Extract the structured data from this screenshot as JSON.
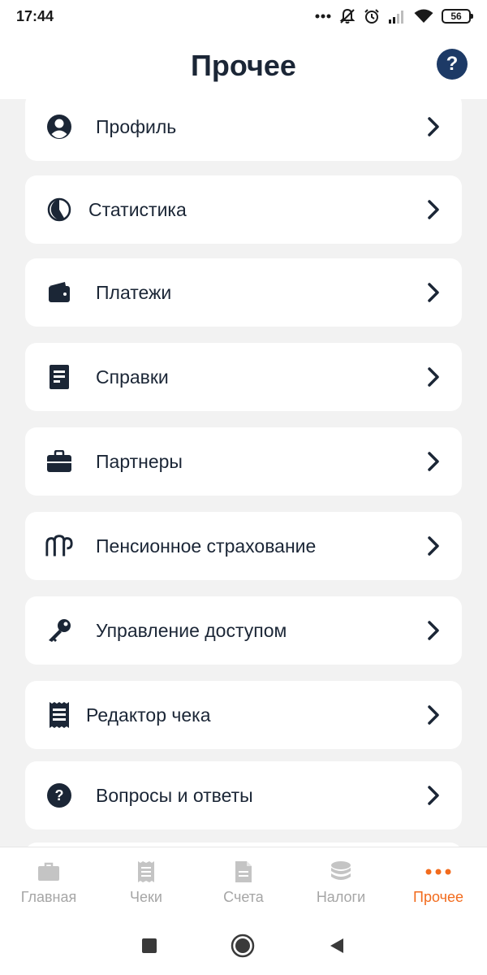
{
  "status_bar": {
    "time": "17:44",
    "battery": "56"
  },
  "header": {
    "title": "Прочее",
    "help": "?"
  },
  "menu": {
    "items": [
      {
        "label": "Профиль",
        "icon": "user-icon"
      },
      {
        "label": "Статистика",
        "icon": "pie-chart-icon"
      },
      {
        "label": "Платежи",
        "icon": "wallet-icon"
      },
      {
        "label": "Справки",
        "icon": "document-icon"
      },
      {
        "label": "Партнеры",
        "icon": "briefcase-icon"
      },
      {
        "label": "Пенсионное страхование",
        "icon": "pension-fund-icon"
      },
      {
        "label": "Управление доступом",
        "icon": "key-icon"
      },
      {
        "label": "Редактор чека",
        "icon": "receipt-icon"
      },
      {
        "label": "Вопросы и ответы",
        "icon": "question-icon"
      }
    ]
  },
  "bottom_nav": {
    "tabs": [
      {
        "label": "Главная",
        "icon": "briefcase-icon",
        "active": false
      },
      {
        "label": "Чеки",
        "icon": "receipt-icon",
        "active": false
      },
      {
        "label": "Счета",
        "icon": "file-icon",
        "active": false
      },
      {
        "label": "Налоги",
        "icon": "coins-icon",
        "active": false
      },
      {
        "label": "Прочее",
        "icon": "more-dots-icon",
        "active": true
      }
    ]
  },
  "colors": {
    "accent": "#f26b1d",
    "primary": "#1b2636",
    "help_bg": "#1d3a66",
    "inactive": "#c4c4c4"
  }
}
